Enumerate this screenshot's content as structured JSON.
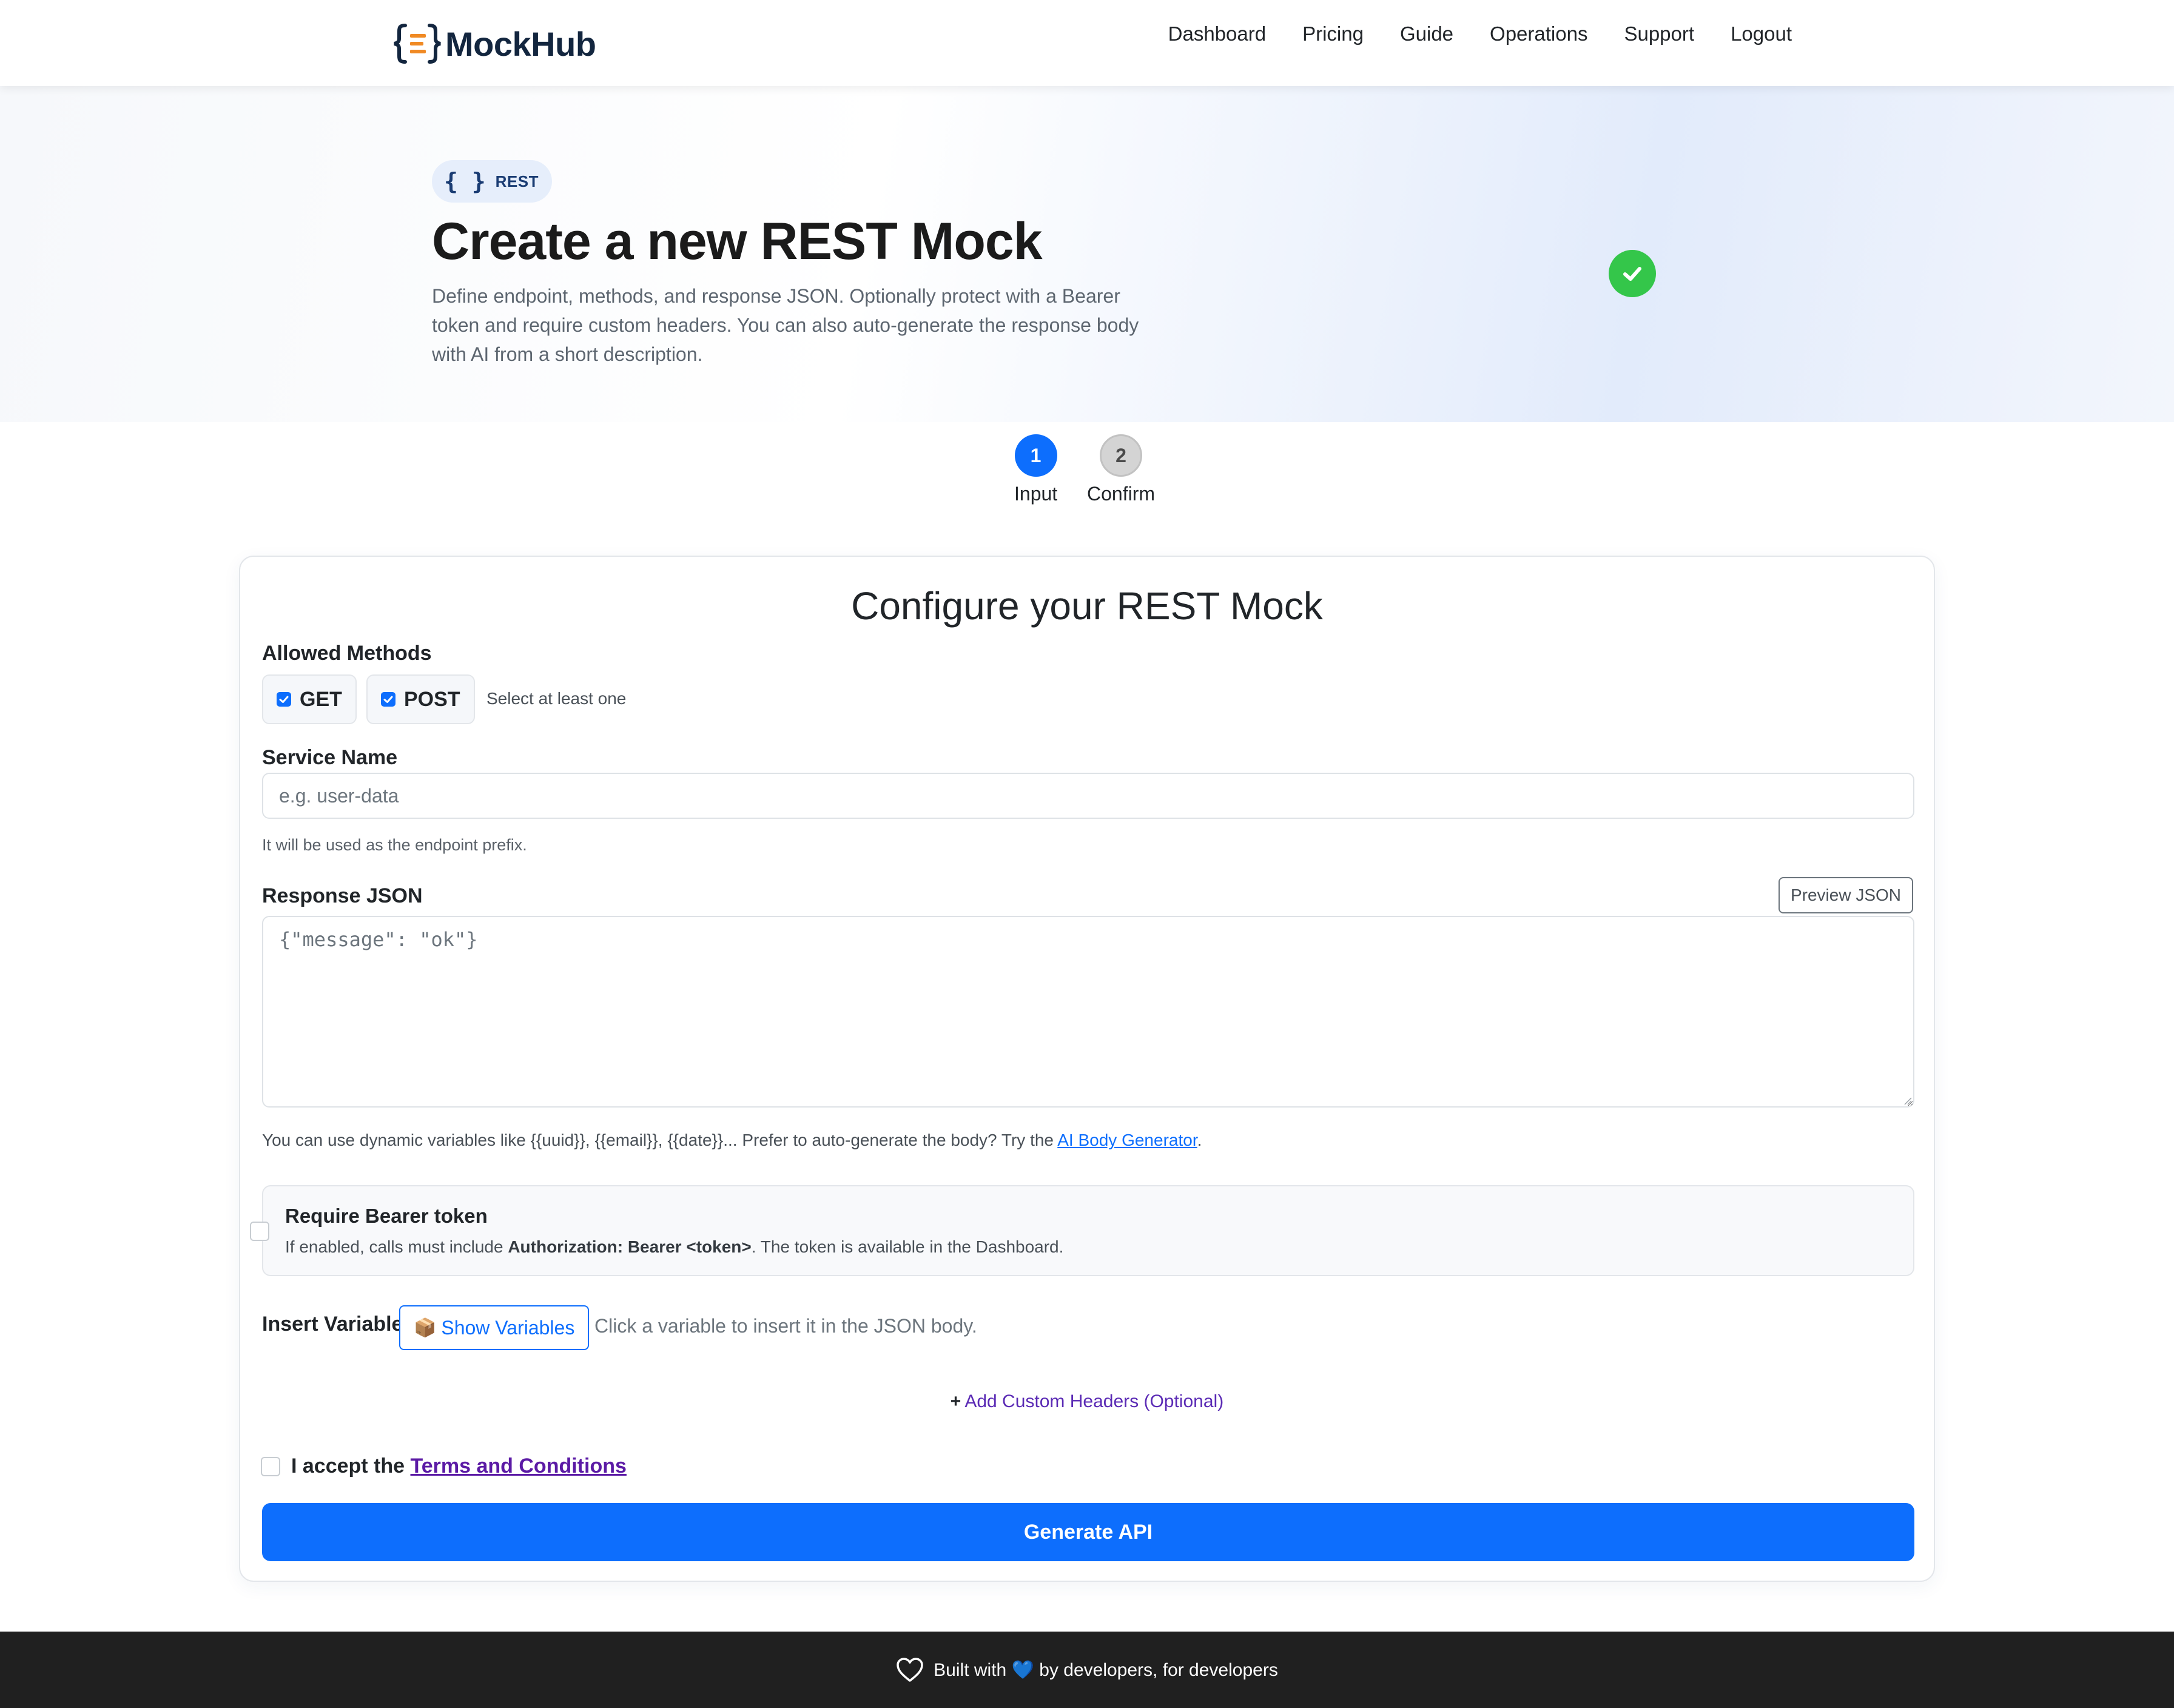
{
  "brand": {
    "name": "MockHub"
  },
  "nav": {
    "items": [
      {
        "label": "Dashboard"
      },
      {
        "label": "Pricing"
      },
      {
        "label": "Guide"
      },
      {
        "label": "Operations"
      },
      {
        "label": "Support"
      },
      {
        "label": "Logout"
      }
    ]
  },
  "hero": {
    "badge_icon": "{ }",
    "badge": "REST",
    "title": "Create a new REST Mock",
    "description": "Define endpoint, methods, and response JSON. Optionally protect with a Bearer token and require custom headers. You can also auto-generate the response body with AI from a short description."
  },
  "stepper": {
    "steps": [
      {
        "number": "1",
        "label": "Input",
        "active": true
      },
      {
        "number": "2",
        "label": "Confirm",
        "active": false
      }
    ]
  },
  "form": {
    "title": "Configure your REST Mock",
    "methods_label": "Allowed Methods",
    "methods": [
      {
        "label": "GET",
        "checked": true
      },
      {
        "label": "POST",
        "checked": true
      }
    ],
    "methods_hint": "Select at least one",
    "service_name": {
      "label": "Service Name",
      "value": "",
      "placeholder": "e.g. user-data",
      "help": "It will be used as the endpoint prefix."
    },
    "response_json": {
      "label": "Response JSON",
      "preview_button": "Preview JSON",
      "value": "{\"message\": \"ok\"}",
      "help_prefix": "You can use dynamic variables like {{uuid}}, {{email}}, {{date}}... Prefer to auto-generate the body? Try the ",
      "help_link": "AI Body Generator",
      "help_suffix": "."
    },
    "bearer": {
      "checked": false,
      "title": "Require Bearer token",
      "desc_prefix": "If enabled, calls must include ",
      "desc_bold": "Authorization: Bearer <token>",
      "desc_suffix": ". The token is available in the Dashboard."
    },
    "variables": {
      "label": "Insert Variable",
      "button_icon": "📦",
      "button": "Show Variables",
      "hint": "Click a variable to insert it in the JSON body."
    },
    "custom_headers": {
      "label": "Add Custom Headers (Optional)"
    },
    "terms": {
      "checked": false,
      "prefix": "I accept the ",
      "link": "Terms and Conditions"
    },
    "submit": "Generate API"
  },
  "footer": {
    "text_before": "Built with ",
    "emoji": "💙",
    "text_after": " by developers, for developers"
  },
  "colors": {
    "primary": "#0d6efd",
    "success": "#34c64a",
    "brand_orange": "#f08a24",
    "brand_navy": "#13263f",
    "footer_bg": "#202020",
    "link_purple": "#5b1aa5"
  }
}
